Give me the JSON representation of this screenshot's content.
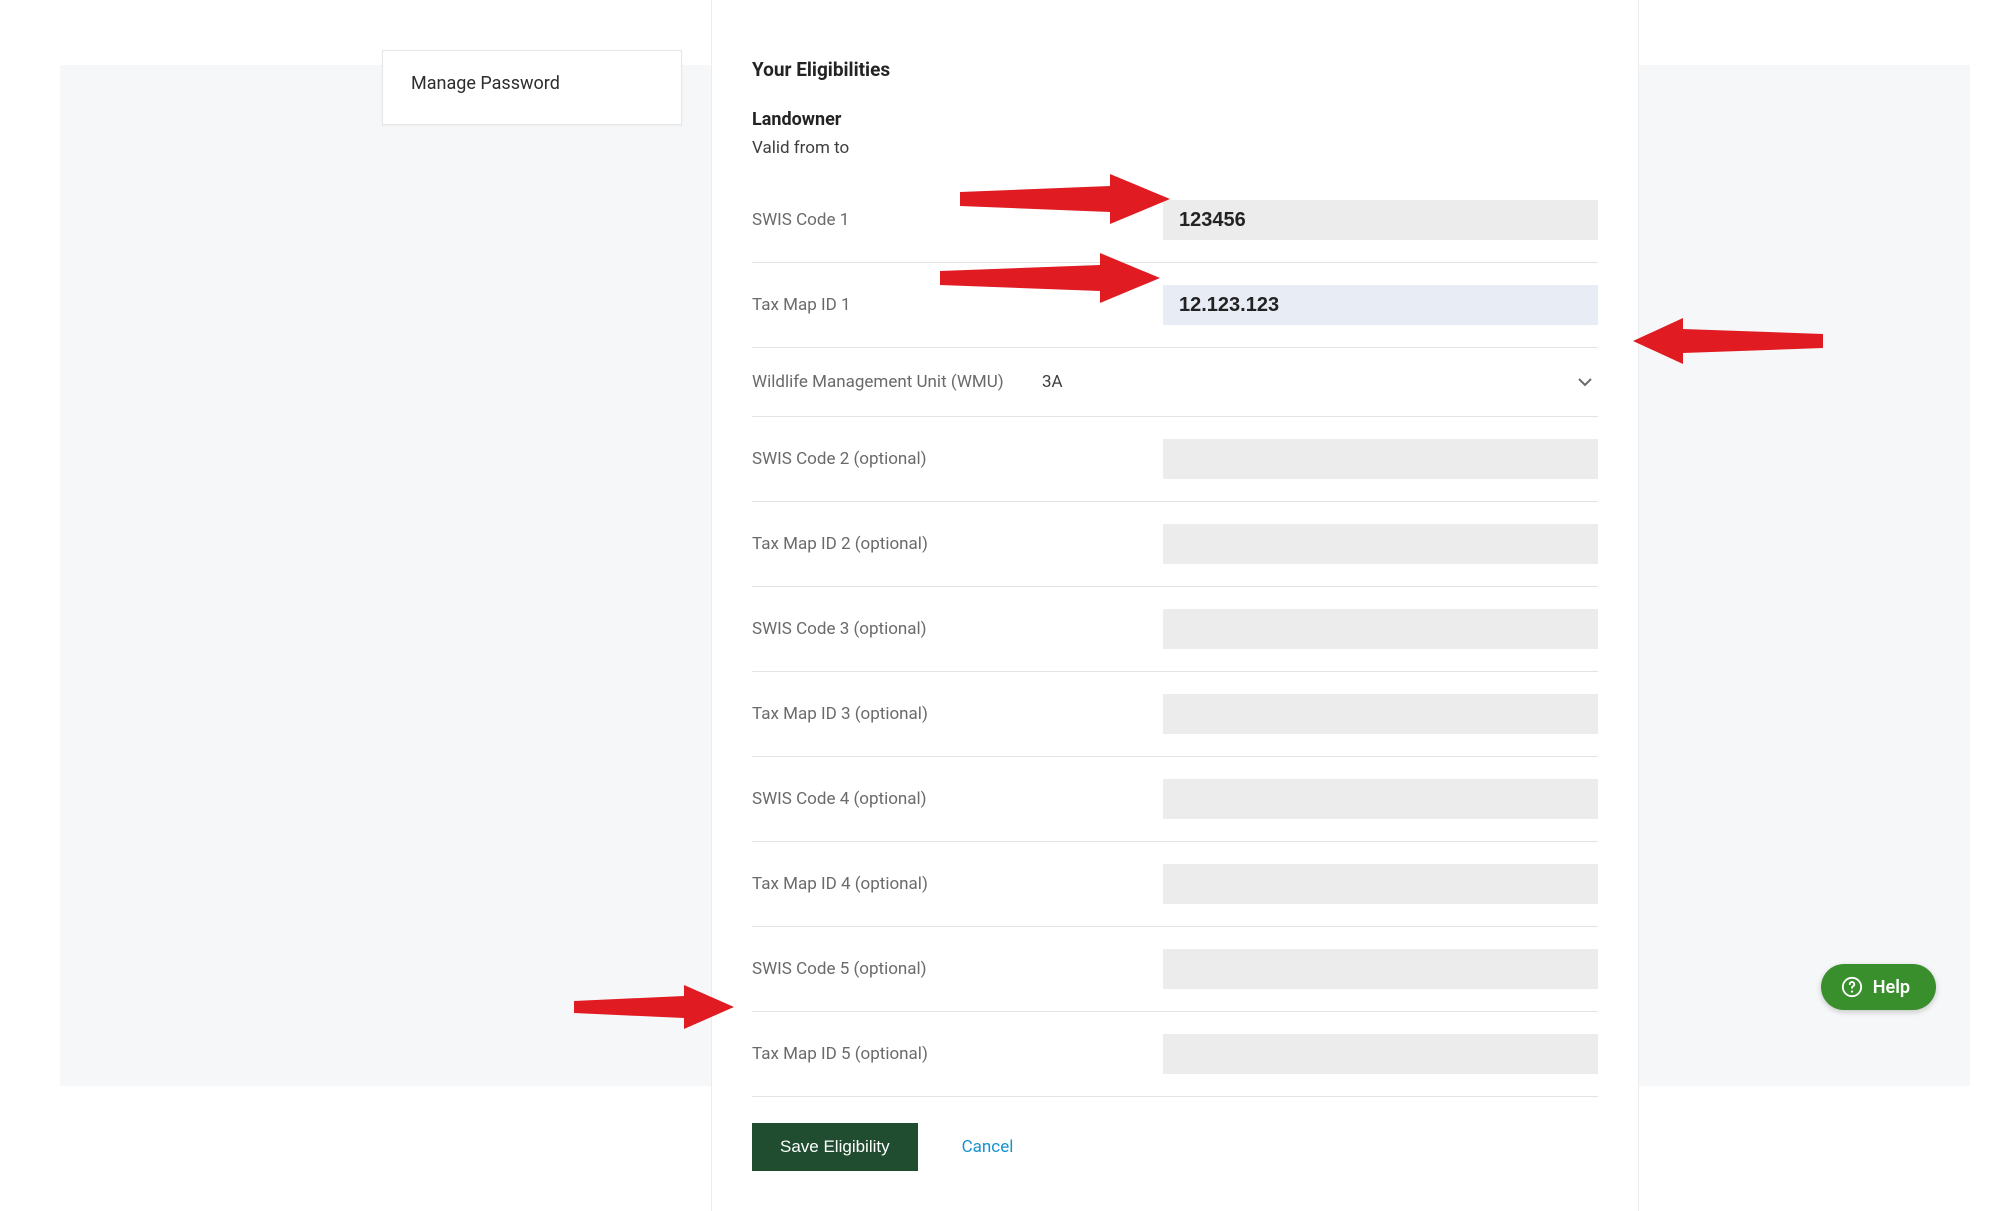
{
  "sidebar": {
    "manage_password": "Manage Password"
  },
  "header": {
    "title": "Your Eligibilities",
    "subtitle": "Landowner",
    "valid_from": "Valid from to"
  },
  "fields": {
    "swis1_label": "SWIS Code 1",
    "swis1_value": "123456",
    "taxmap1_label": "Tax Map ID 1",
    "taxmap1_value": "12.123.123",
    "wmu_label": "Wildlife Management Unit (WMU)",
    "wmu_value": "3A",
    "swis2_label": "SWIS Code 2 (optional)",
    "swis2_value": "",
    "taxmap2_label": "Tax Map ID 2 (optional)",
    "taxmap2_value": "",
    "swis3_label": "SWIS Code 3 (optional)",
    "swis3_value": "",
    "taxmap3_label": "Tax Map ID 3 (optional)",
    "taxmap3_value": "",
    "swis4_label": "SWIS Code 4 (optional)",
    "swis4_value": "",
    "taxmap4_label": "Tax Map ID 4 (optional)",
    "taxmap4_value": "",
    "swis5_label": "SWIS Code 5 (optional)",
    "swis5_value": "",
    "taxmap5_label": "Tax Map ID 5 (optional)",
    "taxmap5_value": ""
  },
  "actions": {
    "save": "Save Eligibility",
    "cancel": "Cancel"
  },
  "help": {
    "label": "Help"
  }
}
